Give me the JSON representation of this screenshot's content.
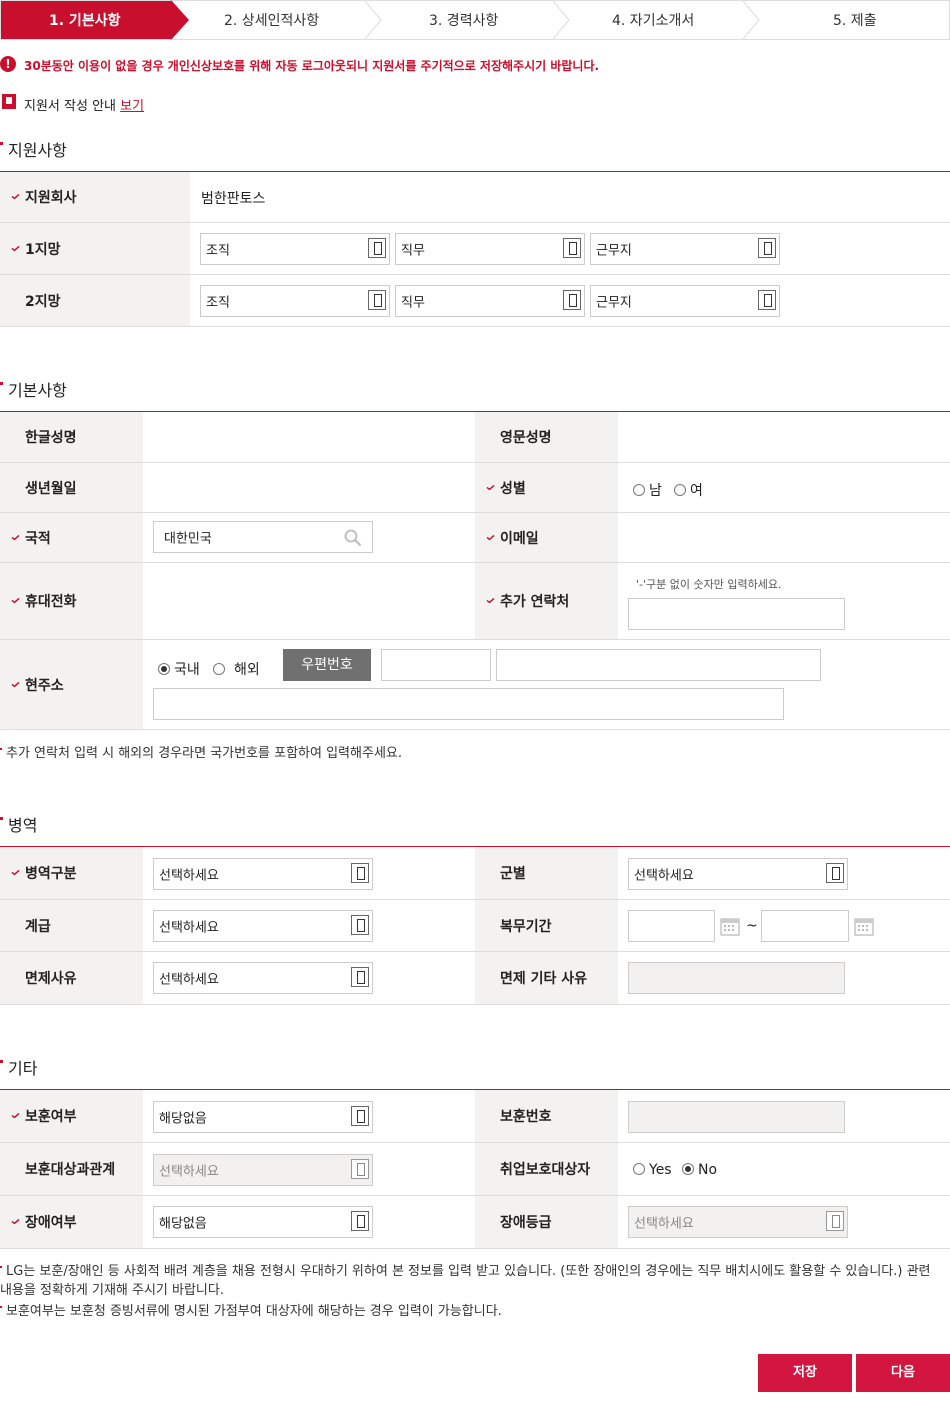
{
  "steps": [
    "1. 기본사항",
    "2. 상세인적사항",
    "3. 경력사항",
    "4. 자기소개서",
    "5. 제출"
  ],
  "notice": "30분동안 이용이 없을 경우 개인신상보호를 위해 자동 로그아웃되니 지원서를 주기적으로 저장해주시기 바랍니다.",
  "guide": {
    "text": "지원서 작성 안내",
    "link": "보기"
  },
  "section_apply": {
    "title": "지원사항",
    "company_label": "지원회사",
    "company_value": "범한판토스",
    "first_label": "1지망",
    "second_label": "2지망",
    "org_placeholder": "조직",
    "job_placeholder": "직무",
    "location_placeholder": "근무지"
  },
  "section_basic": {
    "title": "기본사항",
    "korean_name": "한글성명",
    "english_name": "영문성명",
    "birth": "생년월일",
    "gender": "성별",
    "gender_male": "남",
    "gender_female": "여",
    "nationality": "국적",
    "nationality_value": "대한민국",
    "email": "이메일",
    "mobile": "휴대전화",
    "extra_contact": "추가 연락처",
    "extra_contact_hint": "'-'구분 없이 숫자만 입력하세요.",
    "address": "현주소",
    "domestic": "국내",
    "overseas": "해외",
    "postcode_btn": "우편번호",
    "note": "추가 연락처 입력 시 해외의 경우라면 국가번호를 포함하여 입력해주세요."
  },
  "section_military": {
    "title": "병역",
    "type_label": "병역구분",
    "branch_label": "군별",
    "rank_label": "계급",
    "period_label": "복무기간",
    "exempt_label": "면제사유",
    "exempt_other_label": "면제 기타 사유",
    "select_placeholder": "선택하세요",
    "tilde": "~"
  },
  "section_etc": {
    "title": "기타",
    "veteran_label": "보훈여부",
    "veteran_value": "해당없음",
    "veteran_no_label": "보훈번호",
    "veteran_rel_label": "보훈대상과관계",
    "veteran_rel_value": "선택하세요",
    "employ_protect_label": "취업보호대상자",
    "yes": "Yes",
    "no": "No",
    "disability_label": "장애여부",
    "disability_value": "해당없음",
    "disability_grade_label": "장애등급",
    "disability_grade_value": "선택하세요",
    "note1": "LG는 보훈/장애인 등 사회적 배려 계층을 채용 전형시 우대하기 위하여 본 정보를 입력 받고 있습니다. (또한 장애인의 경우에는 직무 배치시에도 활용할 수 있습니다.) 관련 내용을 정확하게 기재해 주시기 바랍니다.",
    "note2": "보훈여부는 보훈청 증빙서류에 명시된 가점부여 대상자에 해당하는 경우 입력이 가능합니다."
  },
  "buttons": {
    "save": "저장",
    "next": "다음"
  },
  "colors": {
    "accent": "#c8102e",
    "header_bg": "#f4f2f1",
    "button": "#d2163f"
  }
}
